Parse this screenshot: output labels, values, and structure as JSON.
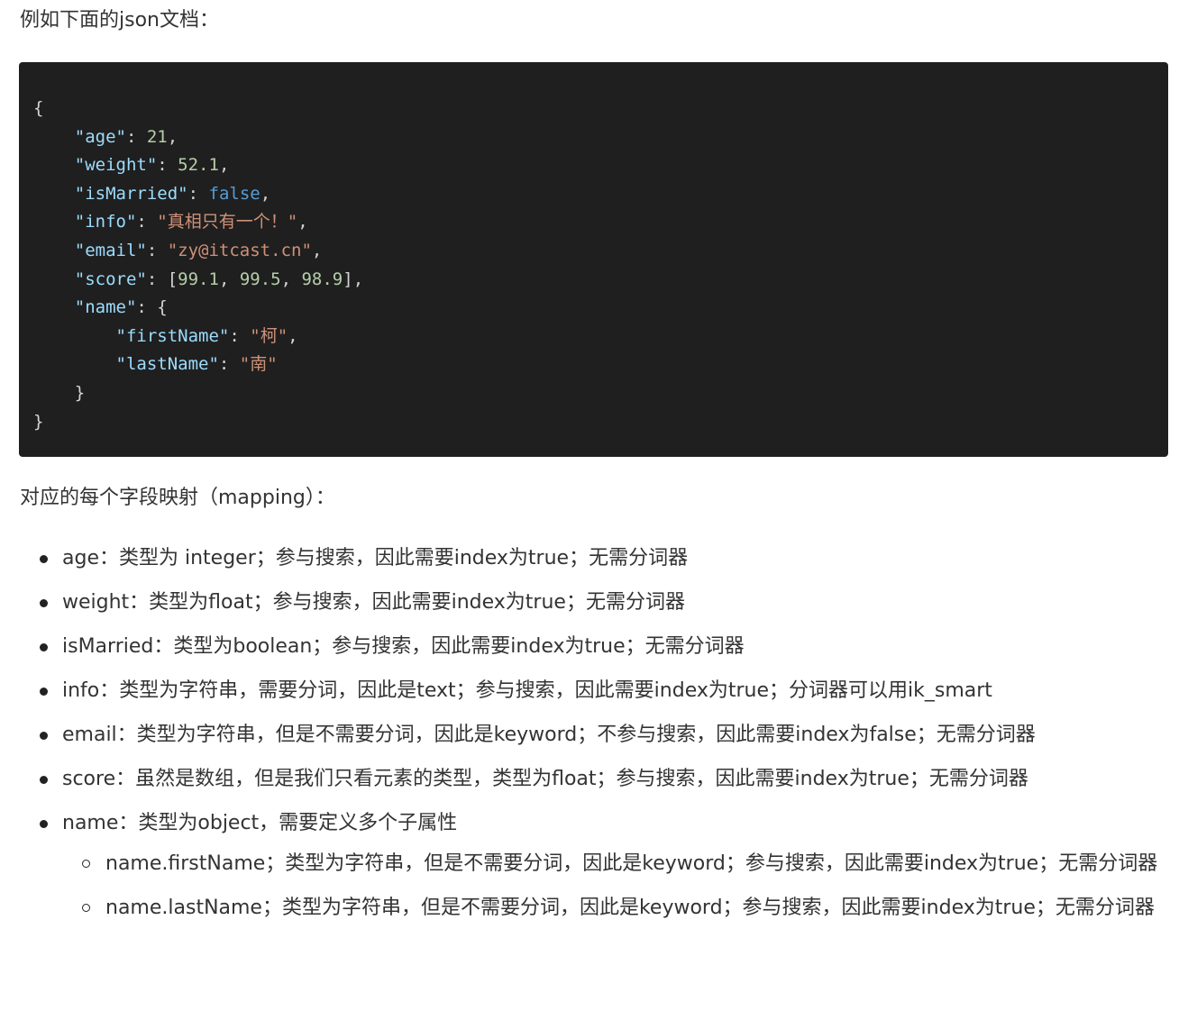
{
  "intro_text": "例如下面的json文档：",
  "code": {
    "line_open": "{",
    "age_key": "\"age\"",
    "age_val": "21",
    "weight_key": "\"weight\"",
    "weight_val": "52.1",
    "married_key": "\"isMarried\"",
    "married_val": "false",
    "info_key": "\"info\"",
    "info_val": "\"真相只有一个！\"",
    "email_key": "\"email\"",
    "email_val": "\"zy@itcast.cn\"",
    "score_key": "\"score\"",
    "score_v1": "99.1",
    "score_v2": "99.5",
    "score_v3": "98.9",
    "name_key": "\"name\"",
    "first_key": "\"firstName\"",
    "first_val": "\"柯\"",
    "last_key": "\"lastName\"",
    "last_val": "\"南\"",
    "line_close_inner": "}",
    "line_close": "}"
  },
  "mapping_title": "对应的每个字段映射（mapping）：",
  "mapping_items": [
    "age：类型为 integer；参与搜索，因此需要index为true；无需分词器",
    "weight：类型为float；参与搜索，因此需要index为true；无需分词器",
    "isMarried：类型为boolean；参与搜索，因此需要index为true；无需分词器",
    "info：类型为字符串，需要分词，因此是text；参与搜索，因此需要index为true；分词器可以用ik_smart",
    "email：类型为字符串，但是不需要分词，因此是keyword；不参与搜索，因此需要index为false；无需分词器",
    "score：虽然是数组，但是我们只看元素的类型，类型为float；参与搜索，因此需要index为true；无需分词器"
  ],
  "name_item": {
    "label": "name：类型为object，需要定义多个子属性",
    "sub_items": [
      "name.firstName；类型为字符串，但是不需要分词，因此是keyword；参与搜索，因此需要index为true；无需分词器",
      "name.lastName；类型为字符串，但是不需要分词，因此是keyword；参与搜索，因此需要index为true；无需分词器"
    ]
  }
}
